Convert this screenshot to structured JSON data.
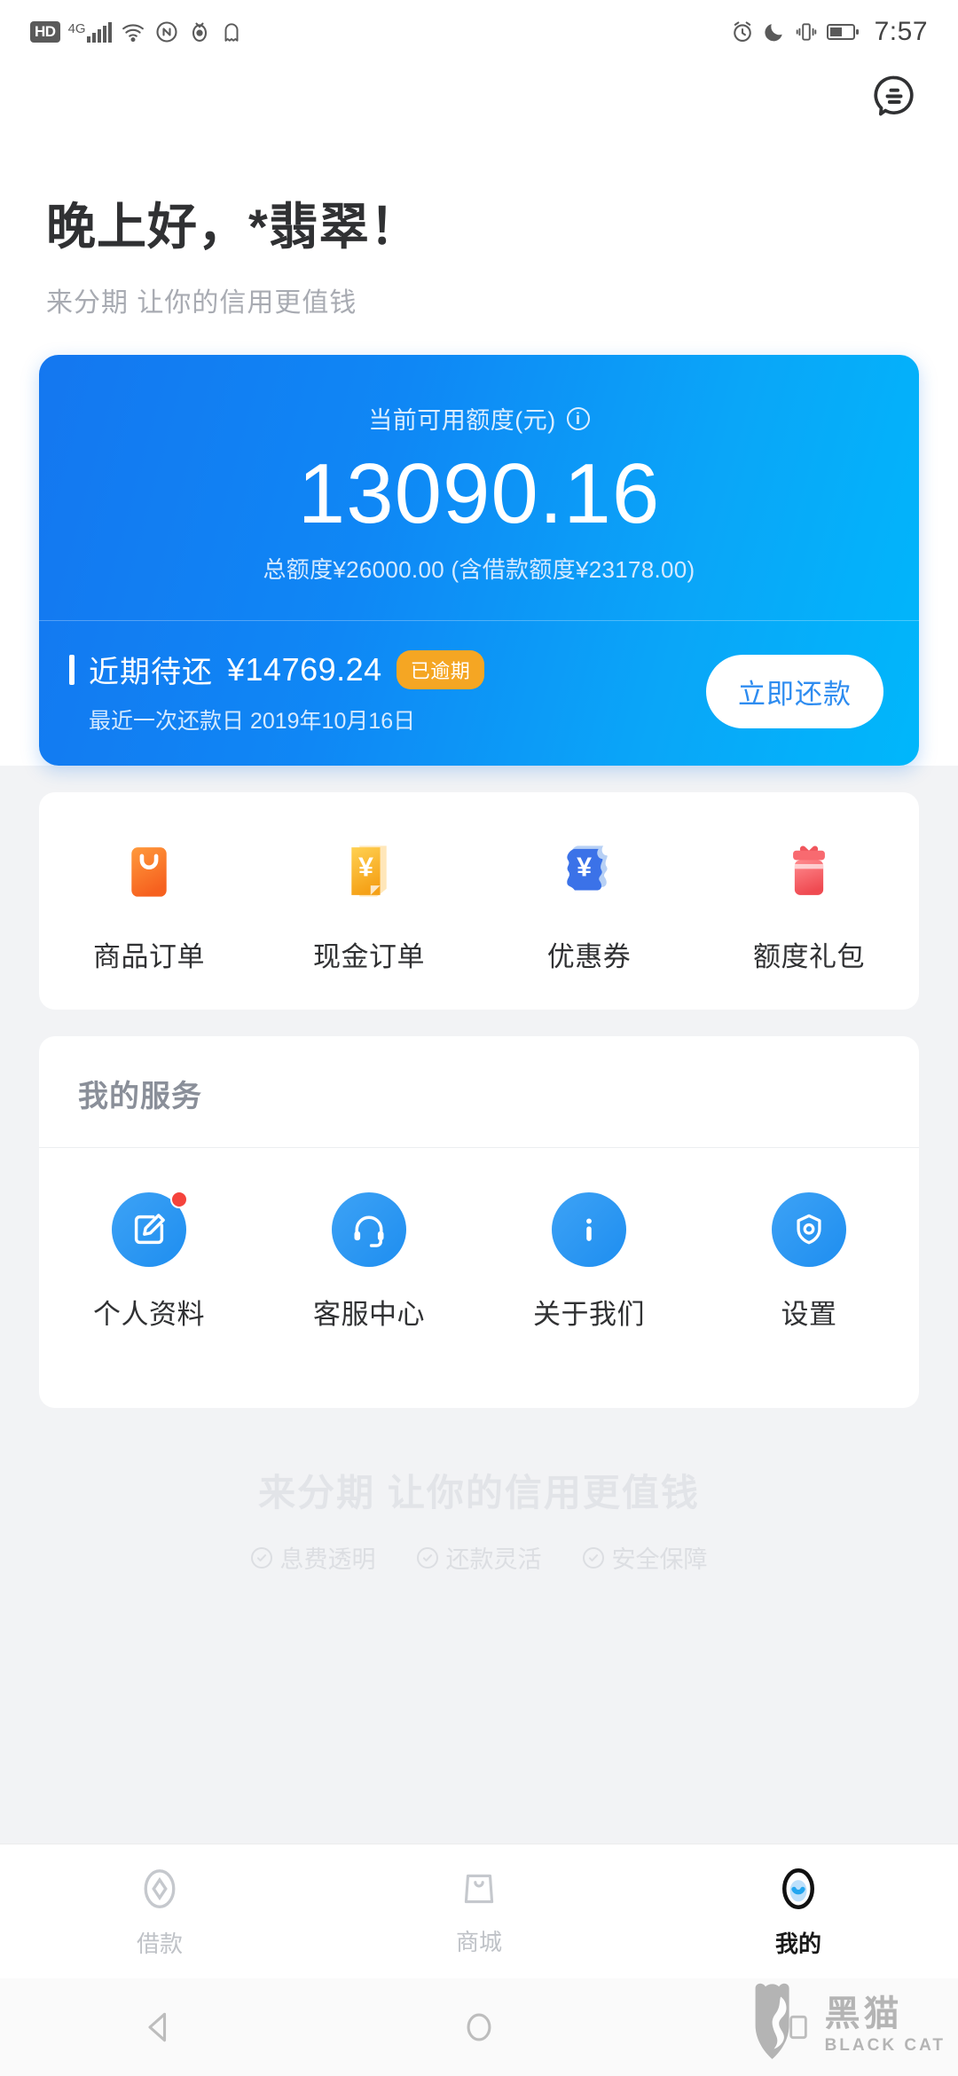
{
  "status_bar": {
    "hd_label": "HD",
    "network_label": "4G",
    "time": "7:57",
    "left_icons": [
      "hd-icon",
      "signal-icon",
      "wifi-icon",
      "data-saver-icon",
      "eye-comfort-icon",
      "ghost-icon"
    ],
    "right_icons": [
      "alarm-icon",
      "do-not-disturb-icon",
      "vibrate-icon",
      "battery-icon"
    ]
  },
  "header": {
    "message_icon": "message-bubble-icon"
  },
  "greeting": {
    "title": "晚上好，*翡翠！",
    "subtitle": "来分期 让你的信用更值钱"
  },
  "credit_card": {
    "available_label": "当前可用额度(元)",
    "info_icon": "info-icon",
    "available_amount": "13090.16",
    "total_line": "总额度¥26000.00 (含借款额度¥23178.00)",
    "due_label": "近期待还",
    "due_amount": "¥14769.24",
    "overdue_badge": "已逾期",
    "due_date_line": "最近一次还款日 2019年10月16日",
    "repay_button": "立即还款",
    "gradient_start": "#1477f0",
    "gradient_end": "#00b7fb",
    "badge_color": "#f5a623"
  },
  "quick_actions": [
    {
      "label": "商品订单",
      "icon": "shopping-bag-icon",
      "color": "#f97316"
    },
    {
      "label": "现金订单",
      "icon": "cash-note-icon",
      "color": "#f5b423"
    },
    {
      "label": "优惠券",
      "icon": "coupon-icon",
      "color": "#3b72e8"
    },
    {
      "label": "额度礼包",
      "icon": "gift-box-icon",
      "color": "#f0555c"
    }
  ],
  "services": {
    "title": "我的服务",
    "items": [
      {
        "label": "个人资料",
        "icon": "profile-edit-icon",
        "badge": true
      },
      {
        "label": "客服中心",
        "icon": "headset-icon",
        "badge": false
      },
      {
        "label": "关于我们",
        "icon": "info-icon",
        "badge": false
      },
      {
        "label": "设置",
        "icon": "settings-shield-icon",
        "badge": false
      }
    ],
    "accent_color": "#2e8cf0"
  },
  "footer": {
    "title": "来分期 让你的信用更值钱",
    "features": [
      "息费透明",
      "还款灵活",
      "安全保障"
    ]
  },
  "tab_bar": {
    "tabs": [
      {
        "label": "借款",
        "icon": "diamond-icon",
        "active": false
      },
      {
        "label": "商城",
        "icon": "shop-bag-icon",
        "active": false
      },
      {
        "label": "我的",
        "icon": "profile-icon",
        "active": true
      }
    ]
  },
  "android_nav": {
    "back_icon": "back-triangle-icon",
    "home_icon": "home-circle-icon",
    "recents_icon": "recents-square-icon"
  },
  "watermark": {
    "cn": "黑猫",
    "en": "BLACK CAT",
    "icon": "black-cat-logo-icon"
  }
}
